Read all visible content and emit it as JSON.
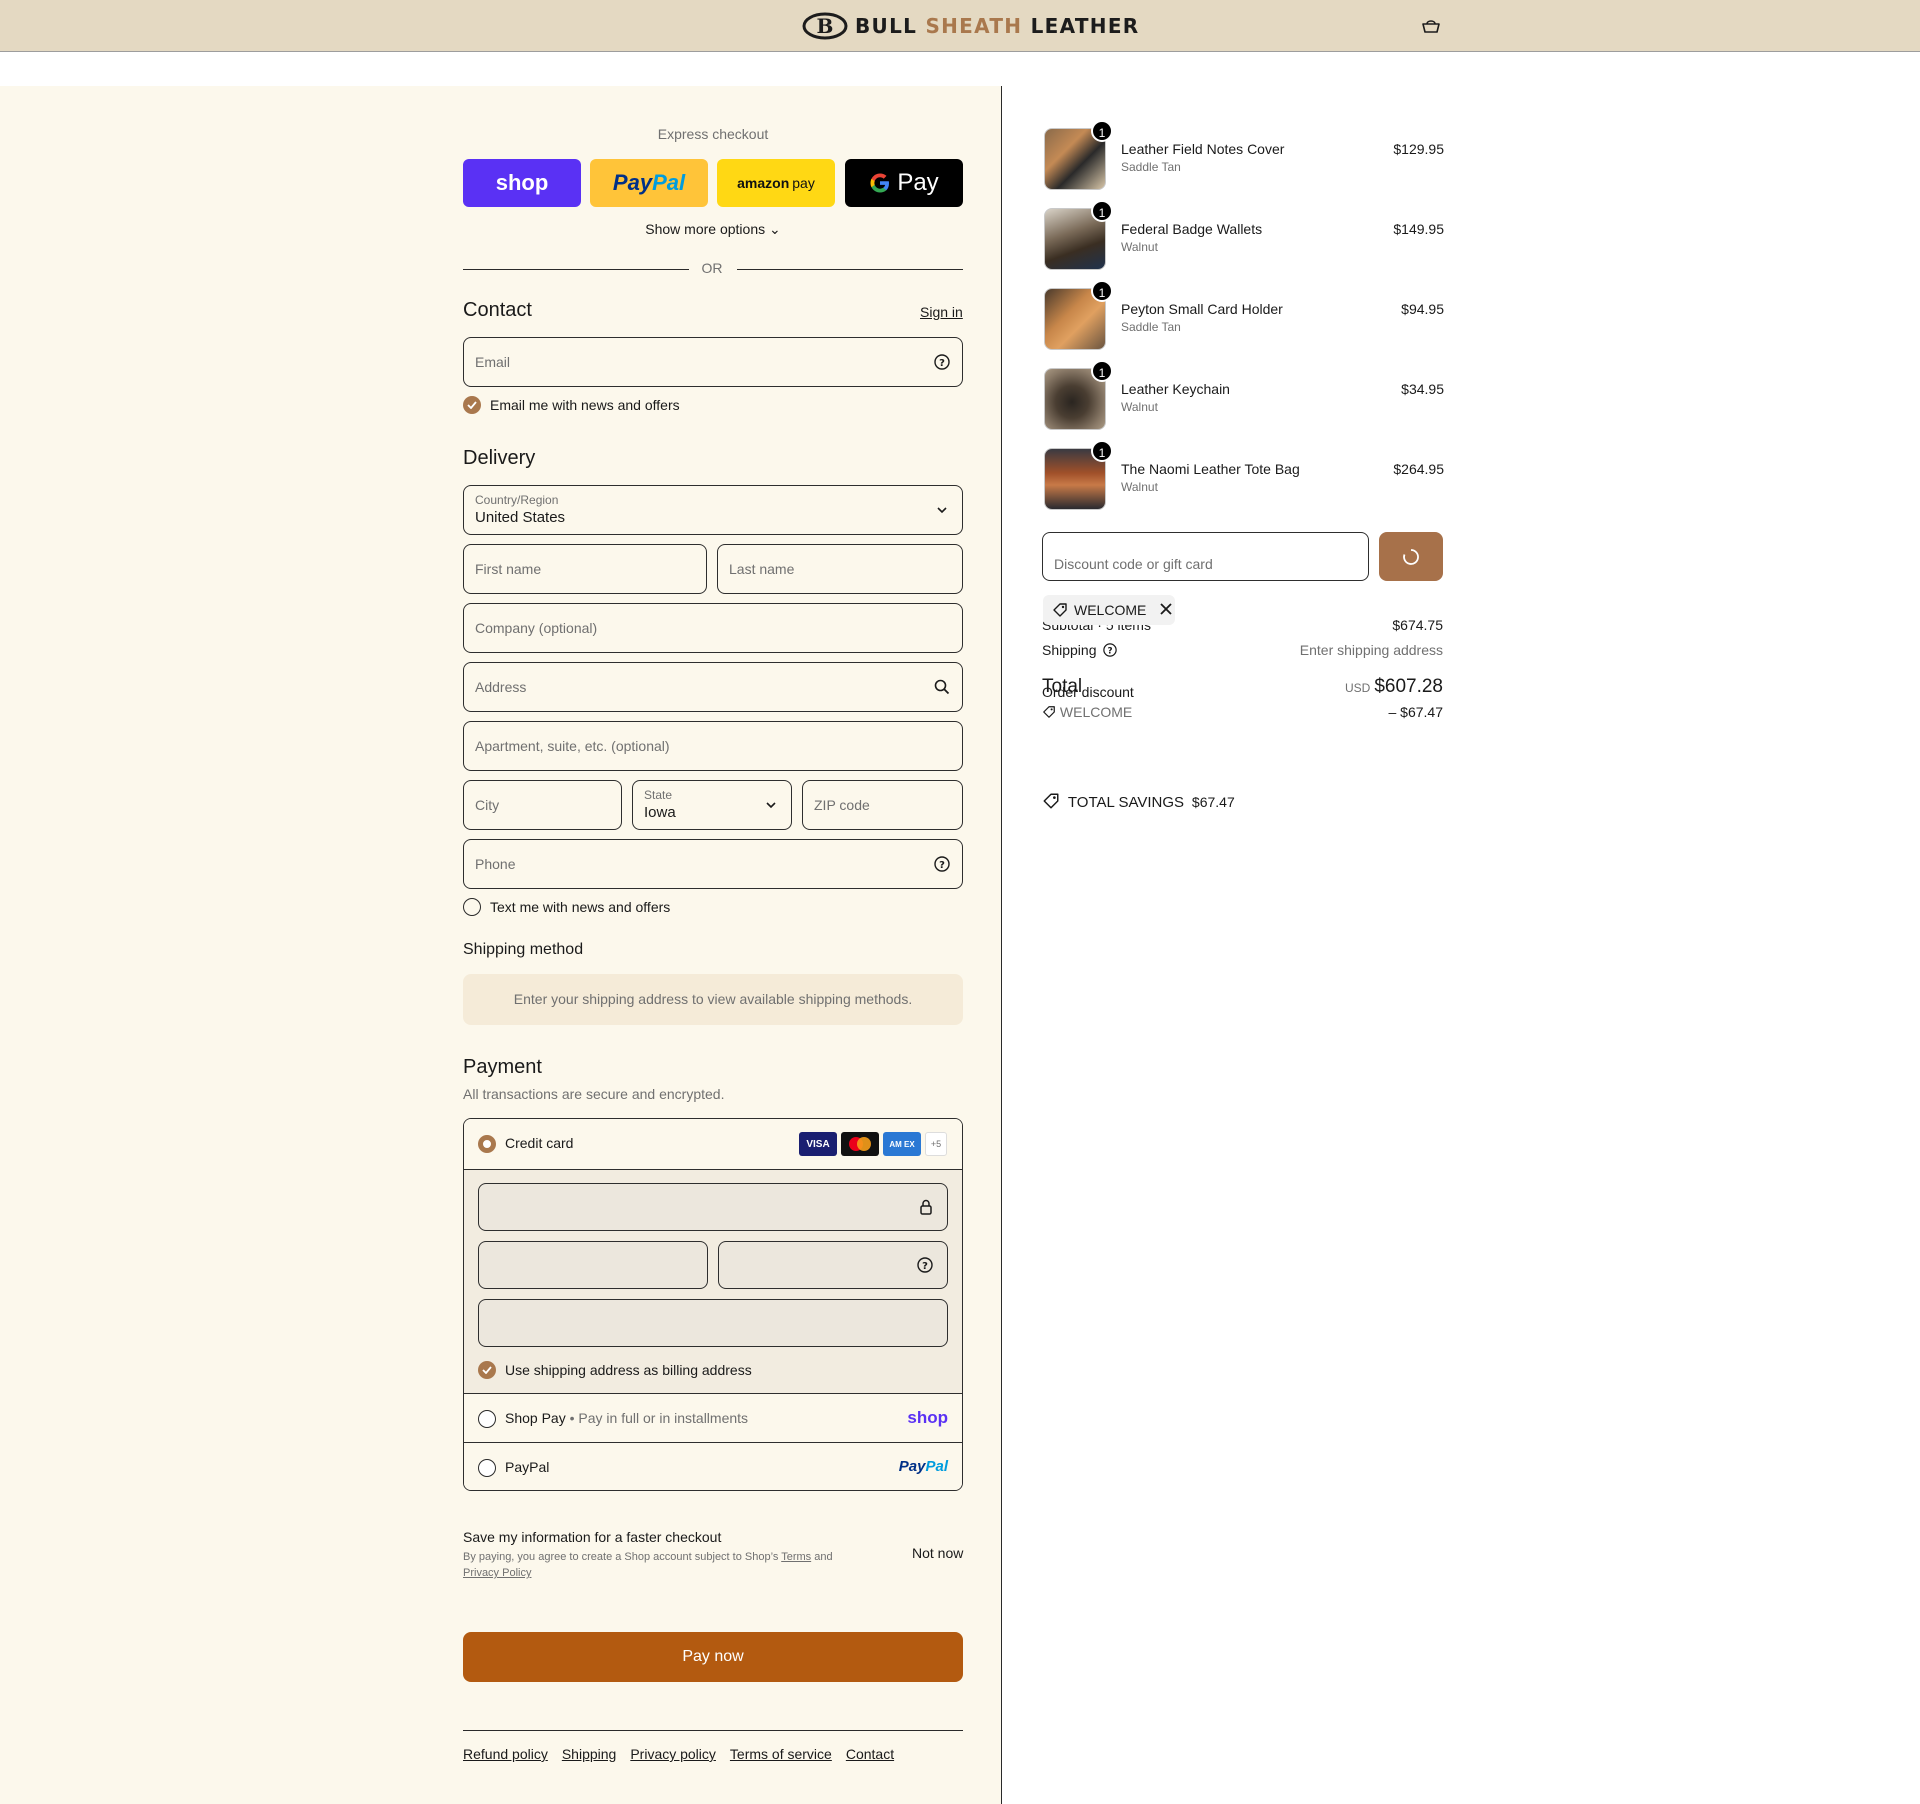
{
  "header": {
    "brand_part1": "BULL ",
    "brand_part2": "SHEATH",
    "brand_part3": " LEATHER",
    "brand_accent_color": "#a9784d",
    "cart_icon": "cart-icon"
  },
  "express": {
    "title": "Express checkout",
    "shop_label": "shop",
    "paypal_a": "Pay",
    "paypal_b": "Pal",
    "amazon_a": "amazon",
    "amazon_b": "pay",
    "gpay_label": "Pay",
    "show_more": "Show more options",
    "or": "OR"
  },
  "contact": {
    "title": "Contact",
    "sign_in": "Sign in",
    "email_placeholder": "Email",
    "email_news": "Email me with news and offers",
    "email_news_checked": true
  },
  "delivery": {
    "title": "Delivery",
    "country_label": "Country/Region",
    "country_value": "United States",
    "first_name": "First name",
    "last_name": "Last name",
    "company": "Company (optional)",
    "address": "Address",
    "apartment": "Apartment, suite, etc. (optional)",
    "city": "City",
    "state_label": "State",
    "state_value": "Iowa",
    "zip": "ZIP code",
    "phone": "Phone",
    "text_news": "Text me with news and offers",
    "text_news_checked": false
  },
  "shipping_method": {
    "title": "Shipping method",
    "message": "Enter your shipping address to view available shipping methods."
  },
  "payment": {
    "title": "Payment",
    "subtitle": "All transactions are secure and encrypted.",
    "credit_card": "Credit card",
    "more_cards": "+5",
    "visa": "VISA",
    "amex": "AM EX",
    "billing_same": "Use shipping address as billing address",
    "billing_same_checked": true,
    "shop_pay": "Shop Pay",
    "shop_pay_sub": "Pay in full or in installments",
    "shop_pay_logo": "shop",
    "paypal": "PayPal",
    "paypal_logo_a": "Pay",
    "paypal_logo_b": "Pal",
    "selected": "Credit card"
  },
  "save_info": {
    "title": "Save my information for a faster checkout",
    "legal_prefix": "By paying, you agree to create a Shop account subject to Shop’s ",
    "terms": "Terms",
    "and": " and",
    "privacy": "Privacy Policy",
    "not_now": "Not now"
  },
  "pay_now": "Pay now",
  "footer": {
    "links": [
      "Refund policy",
      "Shipping",
      "Privacy policy",
      "Terms of service",
      "Contact"
    ]
  },
  "order": {
    "items": [
      {
        "name": "Leather Field Notes Cover",
        "variant": "Saddle Tan",
        "price": "$129.95",
        "qty": "1"
      },
      {
        "name": "Federal Badge Wallets",
        "variant": "Walnut",
        "price": "$149.95",
        "qty": "1"
      },
      {
        "name": "Peyton Small Card Holder",
        "variant": "Saddle Tan",
        "price": "$94.95",
        "qty": "1"
      },
      {
        "name": "Leather Keychain",
        "variant": "Walnut",
        "price": "$34.95",
        "qty": "1"
      },
      {
        "name": "The Naomi Leather Tote Bag",
        "variant": "Walnut",
        "price": "$264.95",
        "qty": "1"
      }
    ],
    "discount_placeholder": "Discount code or gift card",
    "applied_code": "WELCOME",
    "subtotal_label": "Subtotal · 5 items",
    "subtotal": "$674.75",
    "shipping_label": "Shipping",
    "shipping_value": "Enter shipping address",
    "total_label": "Total",
    "currency": "USD",
    "total": "$607.28",
    "order_discount_label": "Order discount",
    "discount_code": "WELCOME",
    "discount_amount": "– $67.47",
    "total_savings_label": "TOTAL SAVINGS",
    "total_savings": "$67.47"
  },
  "colors": {
    "header_bg": "#e4d9c2",
    "page_bg": "#fcf8ec",
    "accent": "#a9784d",
    "pay_now": "#b35a10",
    "shop_purple": "#5a31f4"
  }
}
